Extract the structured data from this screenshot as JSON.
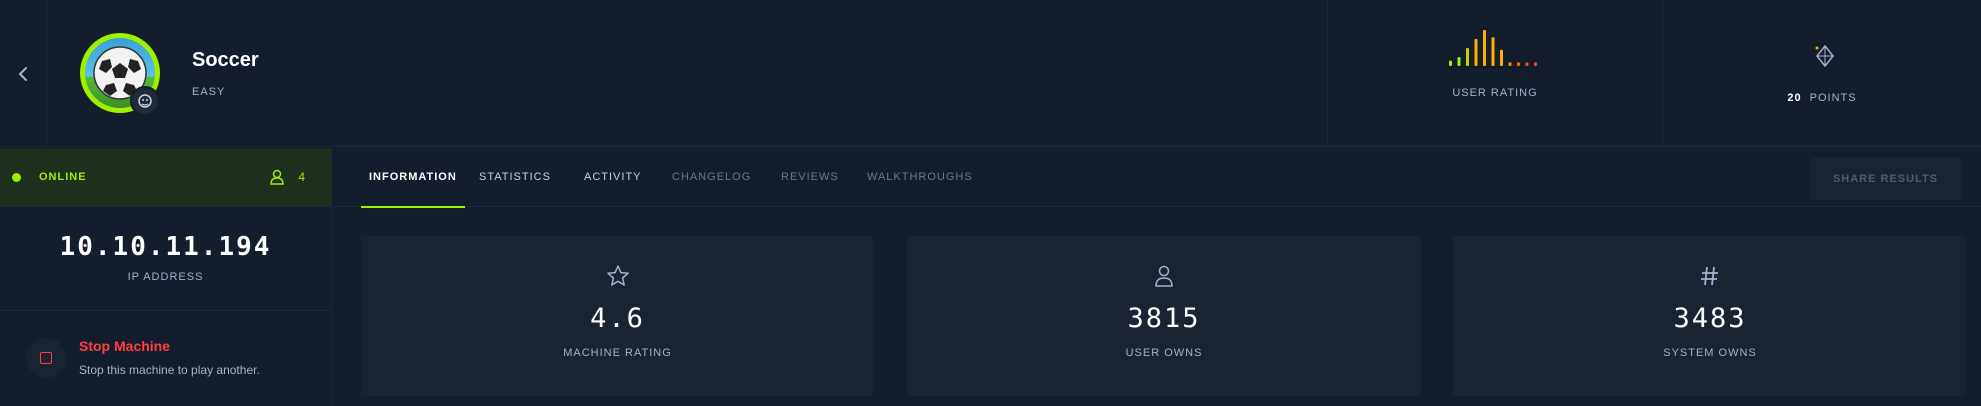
{
  "machine": {
    "name": "Soccer",
    "difficulty": "EASY"
  },
  "header": {
    "user_rating_label": "USER RATING",
    "user_rating_bars": [
      0.15,
      0.25,
      0.5,
      0.75,
      1.0,
      0.8,
      0.45,
      0.1,
      0.1,
      0.1,
      0.1
    ],
    "points_value": "20",
    "points_label": "POINTS"
  },
  "status": {
    "text": "ONLINE",
    "players": "4"
  },
  "ip": {
    "value": "10.10.11.194",
    "label": "IP ADDRESS"
  },
  "stop": {
    "title": "Stop Machine",
    "subtitle": "Stop this machine to play another."
  },
  "tabs": [
    {
      "label": "INFORMATION"
    },
    {
      "label": "STATISTICS"
    },
    {
      "label": "ACTIVITY"
    },
    {
      "label": "CHANGELOG"
    },
    {
      "label": "REVIEWS"
    },
    {
      "label": "WALKTHROUGHS"
    }
  ],
  "share_label": "SHARE RESULTS",
  "stats": [
    {
      "icon": "star-icon",
      "value": "4.6",
      "label": "MACHINE RATING"
    },
    {
      "icon": "user-icon",
      "value": "3815",
      "label": "USER OWNS"
    },
    {
      "icon": "hash-icon",
      "value": "3483",
      "label": "SYSTEM OWNS"
    }
  ],
  "colors": {
    "accent": "#9fef00",
    "danger": "#ff3e3e",
    "bg": "#141d2b",
    "card": "#1a2332"
  }
}
